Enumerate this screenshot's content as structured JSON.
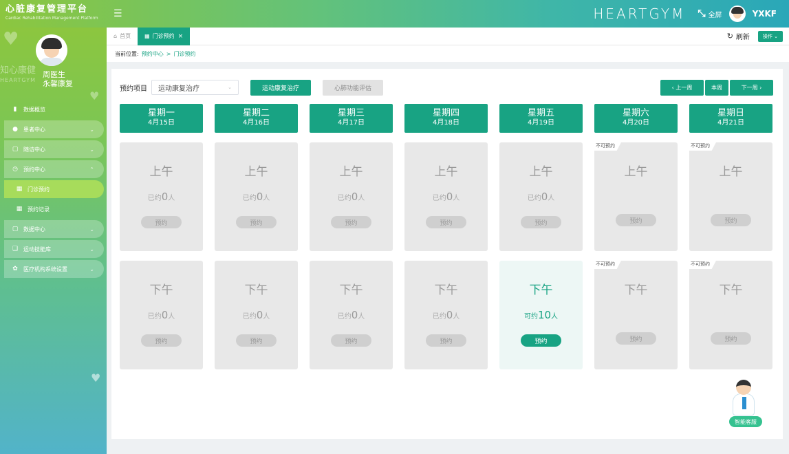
{
  "app": {
    "title": "心脏康复管理平台",
    "subtitle": "Cardiac Rehabilitation Management Platform",
    "menu_toggle_icon": "hamburger-icon",
    "brand": "HEARTGYM",
    "fullscreen_label": "全屏",
    "username": "YXKF"
  },
  "profile": {
    "name": "周医生",
    "org": "永馨康复",
    "watermark": "知心康健",
    "watermark_sub": "HEARTGYM"
  },
  "sidebar": {
    "items": [
      {
        "label": "数据概览",
        "icon": "dashboard-icon",
        "style": "plain"
      },
      {
        "label": "患者中心",
        "icon": "user-icon",
        "chevron": "⌄",
        "style": "pill"
      },
      {
        "label": "随访中心",
        "icon": "folder-icon",
        "chevron": "⌄",
        "style": "pill"
      },
      {
        "label": "预约中心",
        "icon": "calendar-icon",
        "chevron": "⌃",
        "style": "pill"
      },
      {
        "label": "门诊预约",
        "icon": "grid-icon",
        "style": "active"
      },
      {
        "label": "预约记录",
        "icon": "grid-icon",
        "style": "sub"
      },
      {
        "label": "数据中心",
        "icon": "folder-icon",
        "chevron": "⌄",
        "style": "pill"
      },
      {
        "label": "运动技能库",
        "icon": "book-icon",
        "chevron": "⌄",
        "style": "pill"
      },
      {
        "label": "医疗机构系统设置",
        "icon": "gear-icon",
        "chevron": "⌄",
        "style": "pill"
      }
    ]
  },
  "tabs": {
    "home": "首页",
    "active": "门诊预约",
    "refresh": "刷新",
    "ops": "操作 ⌄"
  },
  "breadcrumb": {
    "prefix": "当前位置:",
    "level1": "预约中心",
    "sep": ">",
    "level2": "门诊预约"
  },
  "filter": {
    "label": "预约项目",
    "selected": "运动康复治疗",
    "btn_active": "运动康复治疗",
    "btn_inactive": "心肺功能评估"
  },
  "week_nav": {
    "prev": "‹  上一周",
    "current": "本周",
    "next": "下一周  ›"
  },
  "days": [
    {
      "name": "星期一",
      "date": "4月15日"
    },
    {
      "name": "星期二",
      "date": "4月16日"
    },
    {
      "name": "星期三",
      "date": "4月17日"
    },
    {
      "name": "星期四",
      "date": "4月18日"
    },
    {
      "name": "星期五",
      "date": "4月19日"
    },
    {
      "name": "星期六",
      "date": "4月20日"
    },
    {
      "name": "星期日",
      "date": "4月21日"
    }
  ],
  "slot_text": {
    "morning": "上午",
    "afternoon": "下午",
    "booked_prefix": "已约",
    "available_prefix": "可约",
    "unit": "人",
    "book_btn": "预约",
    "unavailable": "不可预约"
  },
  "slots": {
    "morning": [
      {
        "status": "booked",
        "count": "0"
      },
      {
        "status": "booked",
        "count": "0"
      },
      {
        "status": "booked",
        "count": "0"
      },
      {
        "status": "booked",
        "count": "0"
      },
      {
        "status": "booked",
        "count": "0"
      },
      {
        "status": "unavailable"
      },
      {
        "status": "unavailable"
      }
    ],
    "afternoon": [
      {
        "status": "booked",
        "count": "0"
      },
      {
        "status": "booked",
        "count": "0"
      },
      {
        "status": "booked",
        "count": "0"
      },
      {
        "status": "booked",
        "count": "0"
      },
      {
        "status": "open",
        "count": "10"
      },
      {
        "status": "unavailable"
      },
      {
        "status": "unavailable"
      }
    ]
  },
  "assistant": {
    "label": "智能客服"
  },
  "colors": {
    "accent": "#18a383",
    "sidebar_top": "#8cc63f",
    "sidebar_bottom": "#52b3c9"
  }
}
